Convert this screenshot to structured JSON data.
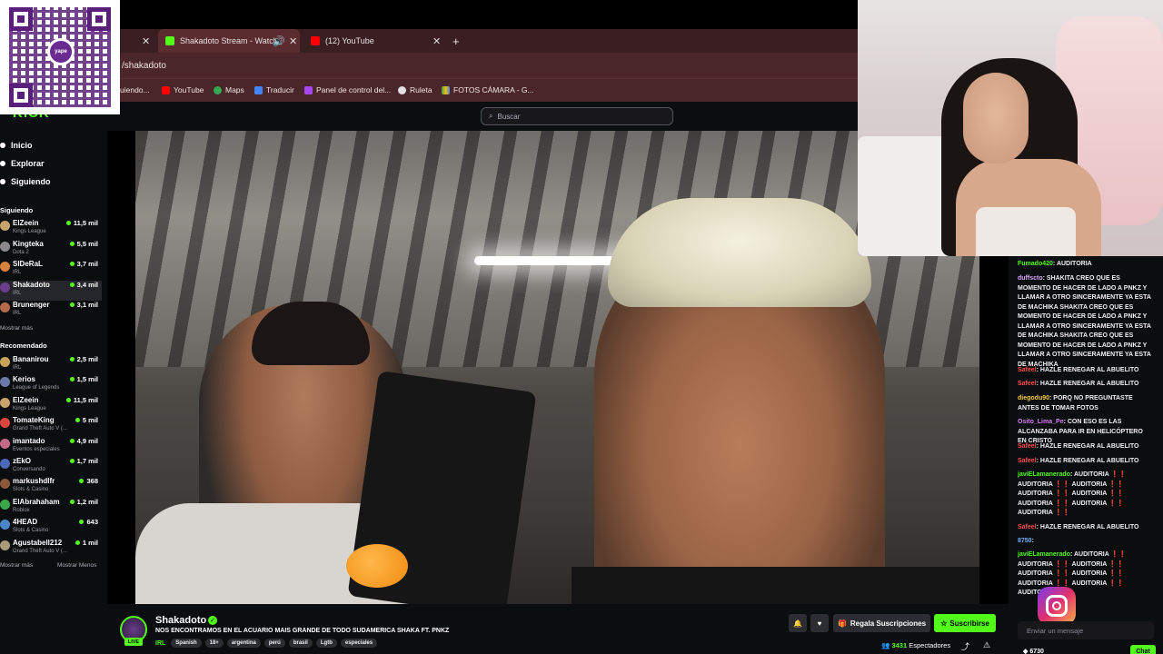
{
  "browser": {
    "tabs": [
      {
        "label": "Shakadoto Stream - Watch"
      },
      {
        "label": "(12) YouTube"
      }
    ],
    "new_tab": "+",
    "url": "/shakadoto",
    "bookmarks": [
      {
        "label": "uiendo..."
      },
      {
        "label": "YouTube"
      },
      {
        "label": "Maps"
      },
      {
        "label": "Traducir"
      },
      {
        "label": "Panel de control del..."
      },
      {
        "label": "Ruleta"
      },
      {
        "label": "FOTOS CÁMARA - G..."
      }
    ]
  },
  "kick": {
    "logo": "KICK",
    "search_placeholder": "Buscar",
    "nav": [
      {
        "label": "Inicio"
      },
      {
        "label": "Explorar"
      },
      {
        "label": "Siguiendo"
      }
    ],
    "following_title": "Siguiendo",
    "following": [
      {
        "name": "ElZeein",
        "category": "Kings League",
        "viewers": "11,5 mil",
        "color": "#c9a46a"
      },
      {
        "name": "Kingteka",
        "category": "Dota 2",
        "viewers": "5,5 mil",
        "color": "#8a8a8a"
      },
      {
        "name": "SIDeRaL",
        "category": "IRL",
        "viewers": "3,7 mil",
        "color": "#d8823c"
      },
      {
        "name": "Shakadoto",
        "category": "IRL",
        "viewers": "3,4 mil",
        "color": "#6a3e8a"
      },
      {
        "name": "Brunenger",
        "category": "IRL",
        "viewers": "3,1 mil",
        "color": "#b56a4a"
      }
    ],
    "following_more": "Mostrar más",
    "recommended_title": "Recomendado",
    "recommended": [
      {
        "name": "Bananirou",
        "category": "IRL",
        "viewers": "2,5 mil",
        "color": "#c7a45a"
      },
      {
        "name": "Kerios",
        "category": "League of Legends",
        "viewers": "1,5 mil",
        "color": "#6a7aa8"
      },
      {
        "name": "ElZeein",
        "category": "Kings League",
        "viewers": "11,5 mil",
        "color": "#c9a46a"
      },
      {
        "name": "TomateKing",
        "category": "Grand Theft Auto V (...",
        "viewers": "5 mil",
        "color": "#d8463c"
      },
      {
        "name": "imantado",
        "category": "Eventos especiales",
        "viewers": "4,9 mil",
        "color": "#c46a86"
      },
      {
        "name": "zEkO",
        "category": "Conversando",
        "viewers": "1,7 mil",
        "color": "#4a6ab8"
      },
      {
        "name": "markushdlfr",
        "category": "Slots & Casino",
        "viewers": "368",
        "color": "#8a5a3a"
      },
      {
        "name": "ElAbrahaham",
        "category": "Roblox",
        "viewers": "1,2 mil",
        "color": "#3aa84a"
      },
      {
        "name": "4HEAD",
        "category": "Slots & Casino",
        "viewers": "643",
        "color": "#4a86c8"
      },
      {
        "name": "Agustabell212",
        "category": "Grand Theft Auto V (...",
        "viewers": "1 mil",
        "color": "#a89a7a"
      }
    ],
    "recommended_more": "Mostrar más",
    "recommended_less": "Mostrar Menos"
  },
  "stream": {
    "name": "Shakadoto",
    "live_badge": "LIVE",
    "title": "NOS ENCONTRAMOS EN EL ACUARIO MAIS GRANDE DE TODO SUDAMERICA SHAKA FT. PNKZ",
    "category": "IRL",
    "tags": [
      "Spanish",
      "18+",
      "argentina",
      "perú",
      "brasil",
      "Lgtb",
      "especiales"
    ],
    "gift_button": "Regala Suscripciones",
    "subscribe_button": "Suscribirse",
    "viewer_count": "3431",
    "viewer_label": "Espectadores"
  },
  "chat": {
    "messages": [
      {
        "user": "Fumado420",
        "color": "#53fc18",
        "text": "AUDITORIA"
      },
      {
        "user": "duffscto",
        "color": "#d7a7f7",
        "text": "SHAKITA CREO QUE ES MOMENTO DE HACER DE LADO A PNKZ Y LLAMAR A OTRO SINCERAMENTE YA ESTA DE MACHIKA SHAKITA CREO QUE ES MOMENTO DE HACER DE LADO A PNKZ Y LLAMAR A OTRO SINCERAMENTE YA ESTA DE MACHIKA SHAKITA CREO QUE ES MOMENTO DE HACER DE LADO A PNKZ Y LLAMAR A OTRO SINCERAMENTE YA ESTA DE MACHIKA"
      },
      {
        "user": "Safeel",
        "color": "#ff4d4d",
        "text": "HAZLE RENEGAR AL ABUELITO"
      },
      {
        "user": "Safeel",
        "color": "#ff4d4d",
        "text": "HAZLE RENEGAR AL ABUELITO"
      },
      {
        "user": "diegodu90",
        "color": "#f7c94a",
        "text": "PORQ NO PREGUNTASTE ANTES DE TOMAR FOTOS"
      },
      {
        "user": "Osito_Lima_Pe",
        "color": "#d77af7",
        "text": "CON ESO ES LAS ALCANZABA PARA IR EN HELICÓPTERO EN CRISTO"
      },
      {
        "user": "Safeel",
        "color": "#ff4d4d",
        "text": "HAZLE RENEGAR AL ABUELITO"
      },
      {
        "user": "Safeel",
        "color": "#ff4d4d",
        "text": "HAZLE RENEGAR AL ABUELITO"
      },
      {
        "user": "javiELamanerado",
        "color": "#53fc18",
        "text": "AUDITORIA ❗❗ AUDITORIA ❗❗ AUDITORIA ❗❗ AUDITORIA ❗❗ AUDITORIA ❗❗ AUDITORIA ❗❗ AUDITORIA ❗❗ AUDITORIA ❗❗"
      },
      {
        "user": "Safeel",
        "color": "#ff4d4d",
        "text": "HAZLE RENEGAR AL ABUELITO"
      },
      {
        "user": "8750",
        "color": "#6ab0ff",
        "text": ""
      },
      {
        "user": "javiELamanerado",
        "color": "#53fc18",
        "text": "AUDITORIA ❗❗ AUDITORIA ❗❗ AUDITORIA ❗❗ AUDITORIA ❗❗ AUDITORIA ❗❗ AUDITORIA ❗❗ AUDITORIA ❗❗ AUDITORIA ❗❗"
      }
    ],
    "input_placeholder": "Enviar un mensaje",
    "send_button": "Chat",
    "points": "6730"
  },
  "overlay": {
    "qr_brand": "yape"
  }
}
